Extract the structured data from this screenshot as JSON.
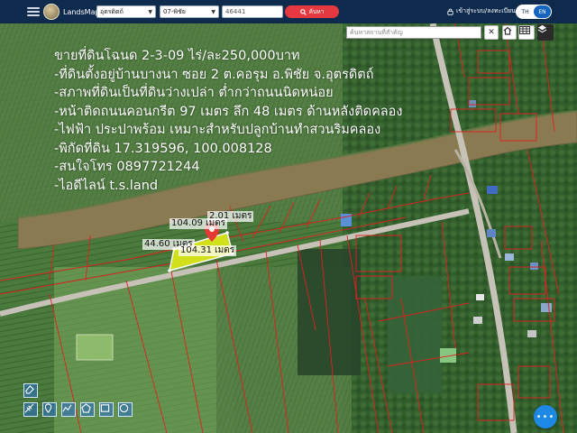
{
  "header": {
    "brand": "LandsMaps",
    "province_select": "อุตรดิตถ์",
    "district_select": "07-พิชัย",
    "parcel_input": "46441",
    "search_button": "ค้นหา",
    "login_link": "เข้าสู่ระบบ/ลงทะเบียน",
    "lang_th": "TH",
    "lang_en": "EN",
    "active_lang": "EN"
  },
  "map": {
    "search_placeholder": "ค้นหาสถานที่สำคัญ",
    "listing_lines": [
      "ขายที่ดินโฉนด 2-3-09 ไร่/ละ250,000บาท",
      "-ที่ดินตั้งอยู่บ้านบางนา ซอย 2 ต.คอรุม อ.พิชัย จ.อุตรดิตถ์",
      "-สภาพที่ดินเป็นที่ดินว่างเปล่า ต่ำกว่าถนนนิดหน่อย",
      "-หน้าติดถนนคอนกรีต 97 เมตร ลึก 48 เมตร ด้านหลังติดคลอง",
      "-ไฟฟ้า ประปาพร้อม เหมาะสำหรับปลูกบ้านทำสวนริมคลอง",
      "-พิกัดที่ดิน 17.319596, 100.008128",
      "-สนใจโทร 0897721244",
      "-ไอดีไลน์ t.s.land"
    ],
    "dimensions": {
      "top_edge": "104.09 เมตร",
      "right_edge": "2.01 เมตร",
      "left_edge": "44.60 เมตร",
      "bottom_edge": "104.31 เมตร"
    },
    "colors": {
      "parcel_outline": "#e02020",
      "selected_parcel": "#d8e61a",
      "canal": "#8a7a52",
      "road": "#c7c2b8",
      "topbar": "#0e2a4d",
      "marker": "#e53935",
      "fab": "#1e88e5"
    }
  },
  "tools": [
    "eraser-icon",
    "ruler-icon",
    "pin-icon",
    "polyline-icon",
    "polygon-icon",
    "rectangle-icon",
    "circle-icon"
  ]
}
